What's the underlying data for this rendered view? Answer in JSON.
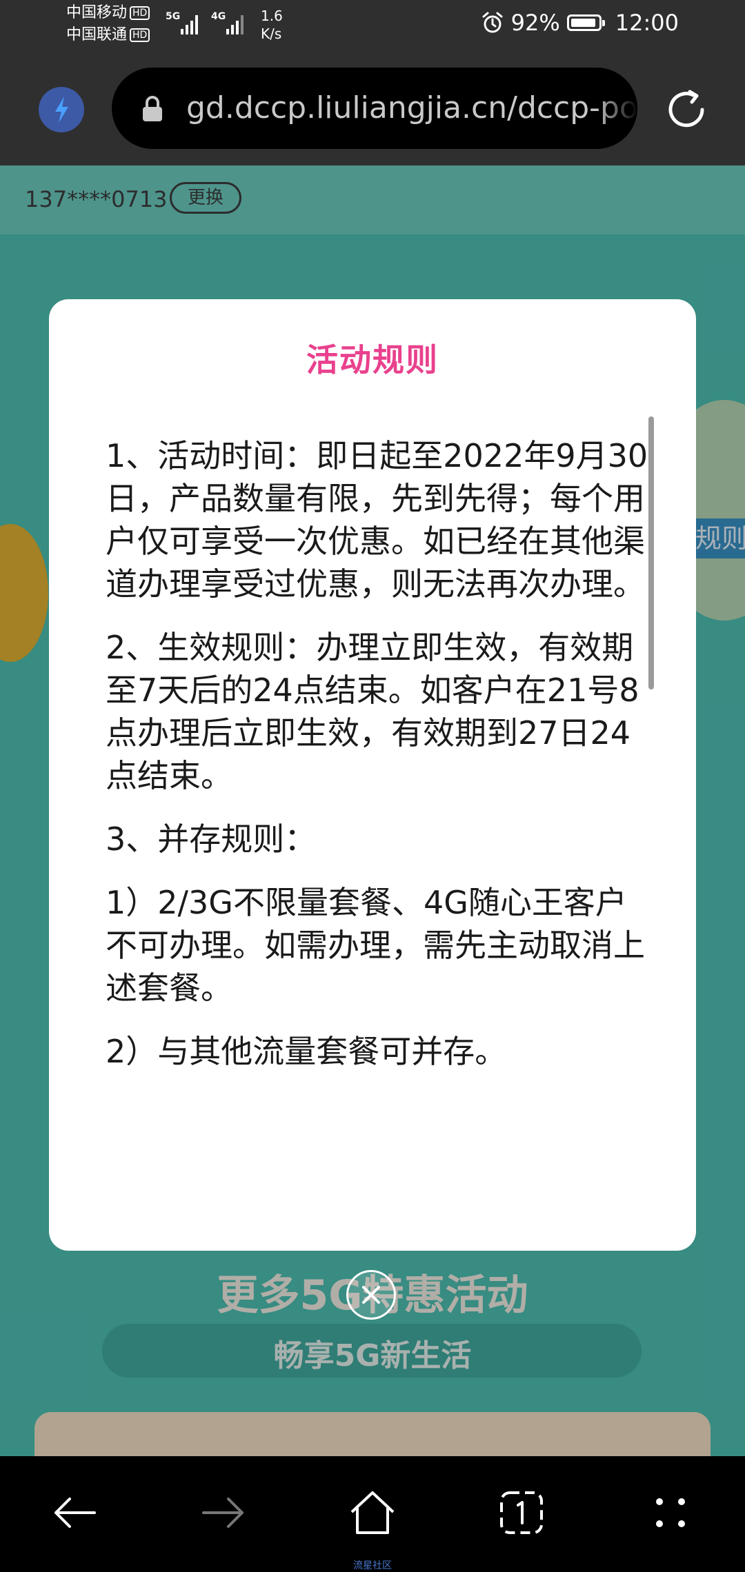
{
  "status_bar": {
    "carrier_1": "中国移动",
    "carrier_2": "中国联通",
    "hd_badge": "HD",
    "network_1": "5G",
    "network_2": "4G",
    "speed_value": "1.6",
    "speed_unit": "K/s",
    "battery": "92%",
    "battery_level": 0.92,
    "time": "12:00"
  },
  "browser": {
    "url": "gd.dccp.liuliangjia.cn/dccp-po"
  },
  "page": {
    "phone_number": "137****0713",
    "change_button": "更换",
    "rules_tab": "规则",
    "promo_title": "更多5G特惠活动",
    "promo_subtitle": "畅享5G新生活"
  },
  "modal": {
    "title": "活动规则",
    "paragraphs": [
      "1、活动时间：即日起至2022年9月30日，产品数量有限，先到先得；每个用户仅可享受一次优惠。如已经在其他渠道办理享受过优惠，则无法再次办理。",
      "2、生效规则：办理立即生效，有效期至7天后的24点结束。如客户在21号8点办理后立即生效，有效期到27日24点结束。",
      "3、并存规则：",
      "1）2/3G不限量套餐、4G随心王客户不可办理。如需办理，需先主动取消上述套餐。",
      "2）与其他流量套餐可并存。"
    ]
  },
  "nav": {
    "caption": "流星社区"
  },
  "colors": {
    "modal_title": "#e9418d",
    "page_teal": "#4ec2b5",
    "bolt_button": "#3d5aa6"
  }
}
